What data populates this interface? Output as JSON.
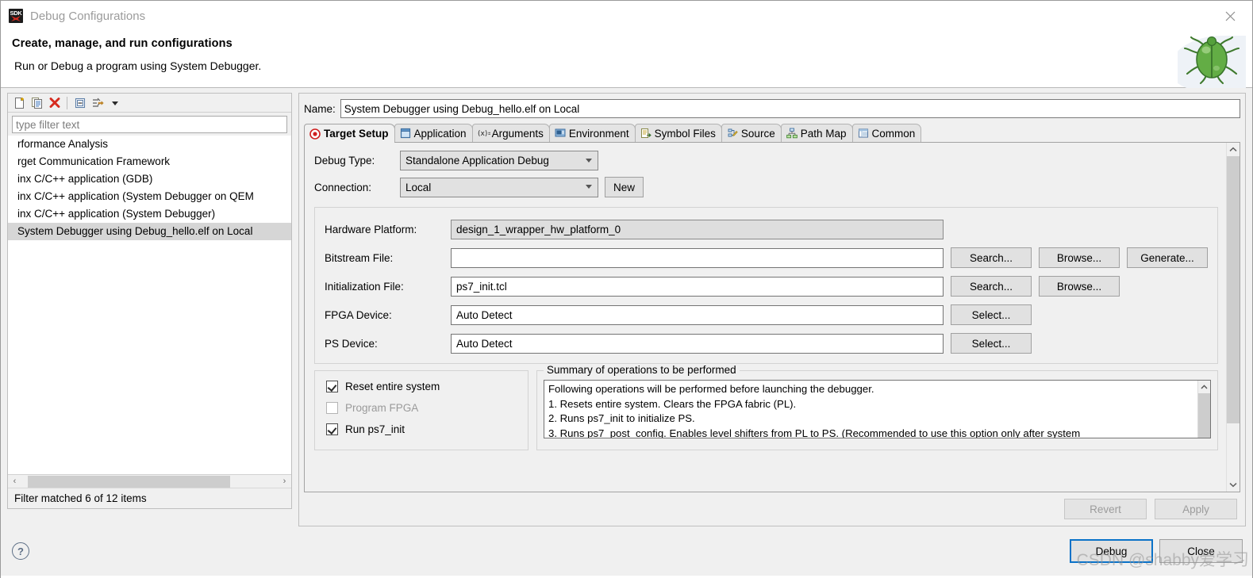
{
  "window": {
    "title": "Debug Configurations",
    "app_icon": "sdk-icon",
    "close_icon": "close-icon"
  },
  "header": {
    "title": "Create, manage, and run configurations",
    "subtitle": "Run or Debug a program using System Debugger.",
    "decor_icon": "green-bug-icon"
  },
  "left_panel": {
    "toolbar": [
      {
        "name": "new-launch-configuration-icon",
        "label": "New launch configuration"
      },
      {
        "name": "duplicate-icon",
        "label": "Duplicate"
      },
      {
        "name": "delete-icon",
        "label": "Delete"
      },
      {
        "name": "collapse-all-icon",
        "label": "Collapse All"
      },
      {
        "name": "filter-icon",
        "label": "Filter launch configurations"
      },
      {
        "name": "chevron-down-icon",
        "label": "View Menu"
      }
    ],
    "filter": {
      "placeholder": "type filter text",
      "value": ""
    },
    "tree_items": [
      "rformance Analysis",
      "rget Communication Framework",
      "inx C/C++ application (GDB)",
      "inx C/C++ application (System Debugger on QEM",
      "inx C/C++ application (System Debugger)",
      "System Debugger using Debug_hello.elf on Local"
    ],
    "selected_index": 5,
    "hscroll": {
      "left_arrow": "‹",
      "right_arrow": "›"
    },
    "status": "Filter matched 6 of 12 items"
  },
  "config": {
    "name_label": "Name:",
    "name_value": "System Debugger using Debug_hello.elf on Local",
    "tabs": [
      {
        "label": "Target Setup",
        "icon": "target-bullseye-icon",
        "active": true
      },
      {
        "label": "Application",
        "icon": "application-window-icon",
        "active": false
      },
      {
        "label": "Arguments",
        "icon": "arguments-variable-icon",
        "active": false
      },
      {
        "label": "Environment",
        "icon": "environment-icon",
        "active": false
      },
      {
        "label": "Symbol Files",
        "icon": "symbol-files-icon",
        "active": false
      },
      {
        "label": "Source",
        "icon": "source-edit-icon",
        "active": false
      },
      {
        "label": "Path Map",
        "icon": "path-map-icon",
        "active": false
      },
      {
        "label": "Common",
        "icon": "common-table-icon",
        "active": false
      }
    ],
    "debug_type": {
      "label": "Debug Type:",
      "value": "Standalone Application Debug"
    },
    "connection": {
      "label": "Connection:",
      "value": "Local",
      "new_button": "New"
    },
    "fields": [
      {
        "label": "Hardware Platform:",
        "value": "design_1_wrapper_hw_platform_0",
        "style": "combo",
        "buttons": []
      },
      {
        "label": "Bitstream File:",
        "value": "",
        "style": "text",
        "buttons": [
          "Search...",
          "Browse...",
          "Generate..."
        ]
      },
      {
        "label": "Initialization File:",
        "value": "ps7_init.tcl",
        "style": "text",
        "buttons": [
          "Search...",
          "Browse..."
        ]
      },
      {
        "label": "FPGA Device:",
        "value": "Auto Detect",
        "style": "text",
        "buttons": [
          "Select..."
        ]
      },
      {
        "label": "PS Device:",
        "value": "Auto Detect",
        "style": "text",
        "buttons": [
          "Select..."
        ]
      }
    ],
    "checkboxes": [
      {
        "label": "Reset entire system",
        "checked": true,
        "enabled": true
      },
      {
        "label": "Program FPGA",
        "checked": false,
        "enabled": false
      },
      {
        "label": "Run ps7_init",
        "checked": true,
        "enabled": true
      }
    ],
    "summary": {
      "legend": "Summary of operations to be performed",
      "lines": [
        "Following operations will be performed before launching the debugger.",
        "1. Resets entire system. Clears the FPGA fabric (PL).",
        "2. Runs ps7_init to initialize PS.",
        "3. Runs ps7_post_config. Enables level shifters from PL to PS. (Recommended to use this option only after system"
      ]
    },
    "revert_button": "Revert",
    "apply_button": "Apply"
  },
  "footer": {
    "help_icon": "help-question-icon",
    "debug_button": "Debug",
    "close_button": "Close",
    "watermark": "CSDN @shabby爱学习"
  },
  "colors": {
    "accent_blue": "#0a72c8",
    "delete_red": "#d62b1f",
    "bug_green": "#5aa845",
    "dialog_bg": "#f0f0f0",
    "selection_gray": "#d6d6d6"
  }
}
